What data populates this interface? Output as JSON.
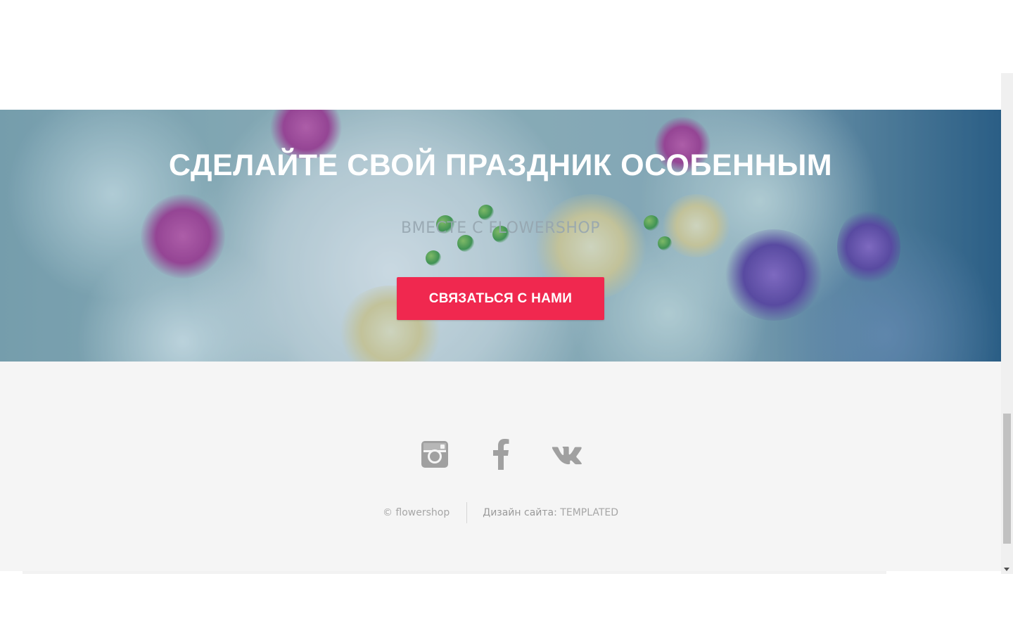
{
  "hero": {
    "title": "СДЕЛАЙТЕ СВОЙ ПРАЗДНИК ОСОБЕННЫМ",
    "subtitle": "ВМЕСТЕ С FLOWERSHOP",
    "cta_label": "СВЯЗАТЬСЯ С НАМИ",
    "cta_color": "#f0284f"
  },
  "footer": {
    "social": [
      {
        "name": "instagram-icon"
      },
      {
        "name": "facebook-icon"
      },
      {
        "name": "vk-icon"
      }
    ],
    "icon_color": "#a0a0a0",
    "copyright": "© flowershop",
    "credits_label": "Дизайн сайта:",
    "credits_link": "TEMPLATED"
  }
}
